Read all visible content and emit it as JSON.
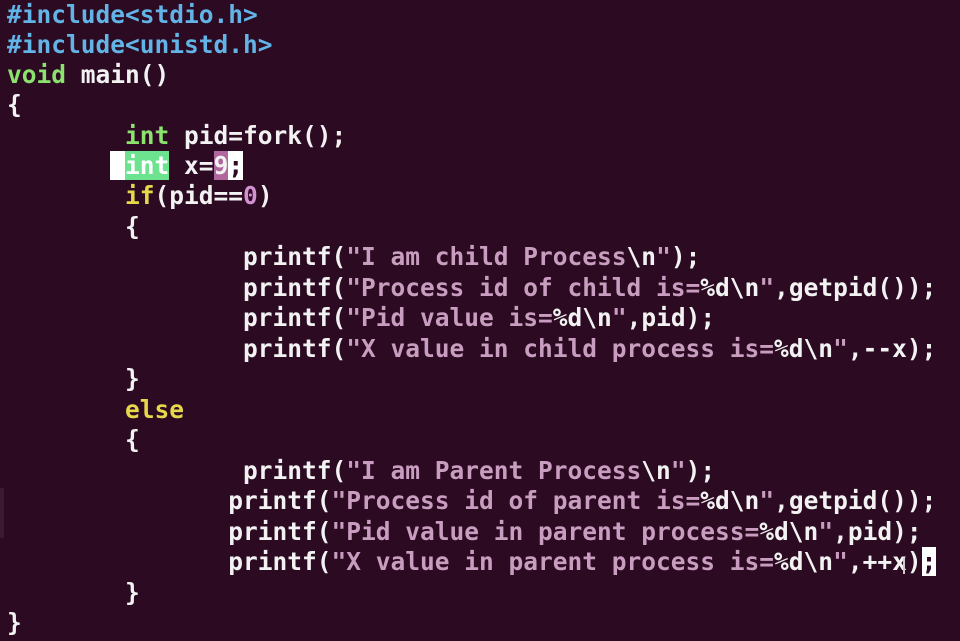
{
  "editor": {
    "background": "#2b0a22",
    "colors": {
      "preprocessor": "#62b3e6",
      "type_keyword": "#8be36e",
      "control_keyword": "#e6d84a",
      "string": "#c99dc0",
      "number": "#d291d1",
      "text": "#f2f2f2"
    },
    "code": {
      "l1_pp": "#include",
      "l1_rest": "<stdio.h>",
      "l2_pp": "#include",
      "l2_rest": "<unistd.h>",
      "l3_kw": "void",
      "l3_rest": " main()",
      "l4": "{",
      "l5_indent": "        ",
      "l5_kw": "int",
      "l5_rest": " pid=fork();",
      "l6_indent": "       ",
      "l6_sel_space": " ",
      "l6_kw": "int",
      "l6_mid": " x=",
      "l6_num": "9",
      "l6_semi": ";",
      "l7_indent": "        ",
      "l7_ctl": "if",
      "l7_mid": "(pid==",
      "l7_num": "0",
      "l7_end": ")",
      "l8": "        {",
      "l9_indent": "                ",
      "l9_fn": "printf(",
      "l9_str": "\"I am child Process",
      "l9_esc": "\\n",
      "l9_str2": "\"",
      "l9_end": ");",
      "l10_indent": "                ",
      "l10_fn": "printf(",
      "l10_str": "\"Process id of child is=",
      "l10_esc": "%d\\n",
      "l10_str2": "\"",
      "l10_end": ",getpid());",
      "l11_indent": "                ",
      "l11_fn": "printf(",
      "l11_str": "\"Pid value is=",
      "l11_esc": "%d\\n",
      "l11_str2": "\"",
      "l11_end": ",pid);",
      "l12_indent": "                ",
      "l12_fn": "printf(",
      "l12_str": "\"X value in child process is=",
      "l12_esc": "%d\\n",
      "l12_str2": "\"",
      "l12_end": ",--x);",
      "l13": "        }",
      "l14_indent": "        ",
      "l14_ctl": "else",
      "l15": "        {",
      "l16_indent": "                ",
      "l16_fn": "printf(",
      "l16_str": "\"I am Parent Process",
      "l16_esc": "\\n",
      "l16_str2": "\"",
      "l16_end": ");",
      "l17_indent": "               ",
      "l17_fn": "printf(",
      "l17_str": "\"Process id of parent is=",
      "l17_esc": "%d\\n",
      "l17_str2": "\"",
      "l17_end": ",getpid());",
      "l18_indent": "               ",
      "l18_fn": "printf(",
      "l18_str": "\"Pid value in parent process=",
      "l18_esc": "%d\\n",
      "l18_str2": "\"",
      "l18_end": ",pid);",
      "l19_indent": "               ",
      "l19_fn": "printf(",
      "l19_str": "\"X value in parent process is=",
      "l19_esc": "%d\\n",
      "l19_str2": "\"",
      "l19_end": ",++x)",
      "l19_cursor": ";",
      "l20": "        }",
      "l21": "}"
    }
  }
}
